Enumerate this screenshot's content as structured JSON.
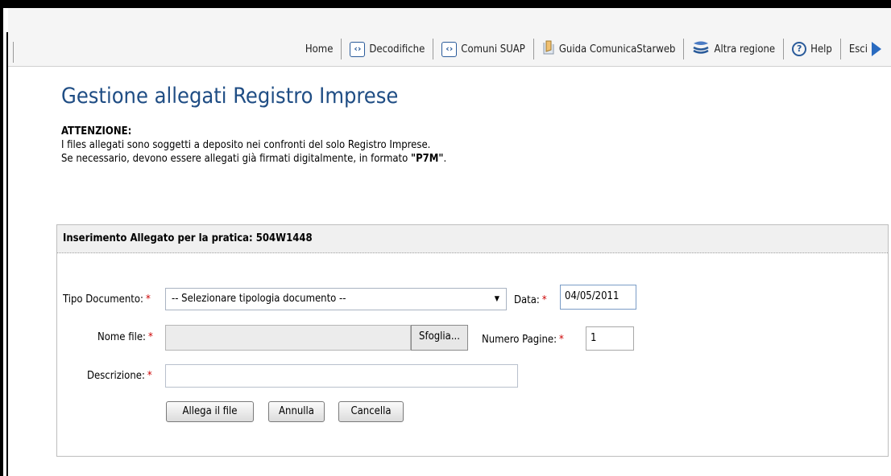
{
  "nav": {
    "items": [
      {
        "label": "Home",
        "icon": ""
      },
      {
        "label": "Decodifiche",
        "icon": "code-icon"
      },
      {
        "label": "Comuni SUAP",
        "icon": "code-icon"
      },
      {
        "label": "Guida ComunicaStarweb",
        "icon": "document-icon"
      },
      {
        "label": "Altra regione",
        "icon": "layers-icon"
      },
      {
        "label": "Help",
        "icon": "help-icon"
      },
      {
        "label": "Esci",
        "icon": "arrow-right-icon"
      }
    ],
    "help_glyph": "?",
    "code_glyph": "‹›"
  },
  "page": {
    "title": "Gestione allegati Registro Imprese",
    "notice_heading": "ATTENZIONE:",
    "notice_line1": "I files allegati sono soggetti a deposito nei confronti del solo Registro Imprese.",
    "notice_line2_prefix": "Se necessario, devono essere allegati già firmati digitalmente, in formato ",
    "notice_line2_format": "\"P7M\"",
    "notice_line2_suffix": "."
  },
  "form": {
    "header": "Inserimento Allegato per la pratica: 504W1448",
    "required_mark": "*",
    "tipo_label": "Tipo Documento:",
    "tipo_value": "-- Selezionare tipologia documento --",
    "data_label": "Data:",
    "data_value": "04/05/2011",
    "nome_file_label": "Nome file:",
    "nome_file_value": "",
    "browse_label": "Sfoglia...",
    "numero_pagine_label": "Numero Pagine:",
    "numero_pagine_value": "1",
    "descrizione_label": "Descrizione:",
    "descrizione_value": "",
    "buttons": {
      "allega": "Allega il file",
      "annulla": "Annulla",
      "cancella": "Cancella"
    }
  },
  "colors": {
    "title": "#1f4d84",
    "required": "#cc0000",
    "icon_blue": "#2a5b9a"
  }
}
